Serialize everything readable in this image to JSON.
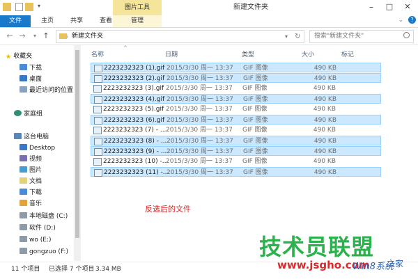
{
  "window": {
    "title": "新建文件夹",
    "context_tab": "图片工具",
    "minimize": "–",
    "maximize": "□",
    "close": "✕"
  },
  "ribbon": {
    "tabs": [
      "文件",
      "主页",
      "共享",
      "查看",
      "管理"
    ]
  },
  "address": {
    "path": "新建文件夹",
    "search_placeholder": "搜索\"新建文件夹\""
  },
  "nav": {
    "favorites": "收藏夹",
    "fav_items": [
      "下载",
      "桌面",
      "最近访问的位置"
    ],
    "homegroup": "家庭组",
    "this_pc": "这台电脑",
    "pc_items": [
      "Desktop",
      "视频",
      "图片",
      "文档",
      "下载",
      "音乐",
      "本地磁盘 (C:)",
      "软件 (D:)",
      "wo (E:)",
      "gongzuo (F:)"
    ]
  },
  "columns": {
    "name": "名称",
    "date": "日期",
    "type": "类型",
    "size": "大小",
    "tags": "标记"
  },
  "files": [
    {
      "name": "2223232323 (1).gif",
      "date": "2015/3/30 周一 13:37",
      "type": "GIF 图像",
      "size": "490 KB",
      "selected": true
    },
    {
      "name": "2223232323 (2).gif",
      "date": "2015/3/30 周一 13:37",
      "type": "GIF 图像",
      "size": "490 KB",
      "selected": true
    },
    {
      "name": "2223232323 (3).gif",
      "date": "2015/3/30 周一 13:37",
      "type": "GIF 图像",
      "size": "490 KB",
      "selected": false
    },
    {
      "name": "2223232323 (4).gif",
      "date": "2015/3/30 周一 13:37",
      "type": "GIF 图像",
      "size": "490 KB",
      "selected": true
    },
    {
      "name": "2223232323 (5).gif",
      "date": "2015/3/30 周一 13:37",
      "type": "GIF 图像",
      "size": "490 KB",
      "selected": false
    },
    {
      "name": "2223232323 (6).gif",
      "date": "2015/3/30 周一 13:37",
      "type": "GIF 图像",
      "size": "490 KB",
      "selected": true
    },
    {
      "name": "2223232323 (7) - ...",
      "date": "2015/3/30 周一 13:37",
      "type": "GIF 图像",
      "size": "490 KB",
      "selected": false
    },
    {
      "name": "2223232323 (8) - ...",
      "date": "2015/3/30 周一 13:37",
      "type": "GIF 图像",
      "size": "490 KB",
      "selected": true
    },
    {
      "name": "2223232323 (9) - ...",
      "date": "2015/3/30 周一 13:37",
      "type": "GIF 图像",
      "size": "490 KB",
      "selected": true
    },
    {
      "name": "2223232323 (10) -...",
      "date": "2015/3/30 周一 13:37",
      "type": "GIF 图像",
      "size": "490 KB",
      "selected": false
    },
    {
      "name": "2223232323 (11) -...",
      "date": "2015/3/30 周一 13:37",
      "type": "GIF 图像",
      "size": "490 KB",
      "selected": true
    }
  ],
  "annotation": "反选后的文件",
  "status": {
    "count": "11 个项目",
    "selection": "已选择 7 个项目",
    "size": "3.34 MB"
  },
  "watermark": {
    "brand": "技术员联盟",
    "url": "www.jsgho.com",
    "url2": "Win8系统",
    "sub": "之家"
  },
  "colors": {
    "selection_fill": "#cce8ff",
    "selection_border": "#99d1ff",
    "file_tab": "#1979ca",
    "context_tab": "#f5e59a"
  }
}
